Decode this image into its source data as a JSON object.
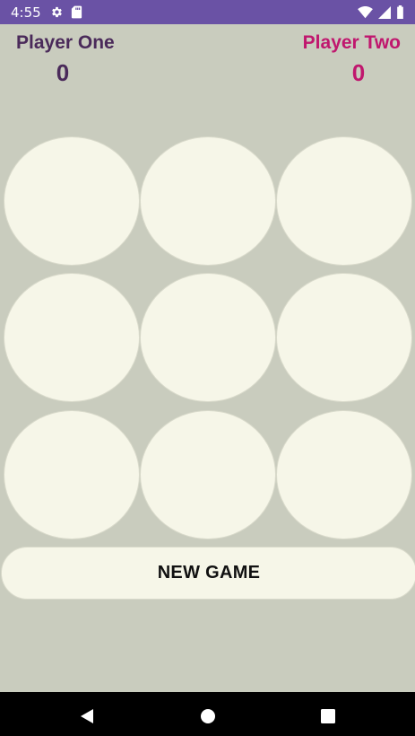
{
  "status_bar": {
    "time": "4:55",
    "icons_left": [
      "gear-icon",
      "sd-card-icon"
    ],
    "icons_right": [
      "wifi-icon",
      "signal-icon",
      "battery-icon"
    ],
    "background": "#6a52a5"
  },
  "scoreboard": {
    "player_one": {
      "name": "Player One",
      "score": "0",
      "color": "#4a2a5a"
    },
    "player_two": {
      "name": "Player Two",
      "score": "0",
      "color": "#c0176e"
    }
  },
  "board": {
    "rows": 3,
    "cols": 3,
    "cells": [
      "",
      "",
      "",
      "",
      "",
      "",
      "",
      "",
      ""
    ],
    "cell_color": "#f6f6e8"
  },
  "new_game_button": {
    "label": "NEW GAME"
  },
  "navigation": {
    "buttons": [
      "back-icon",
      "home-icon",
      "recents-icon"
    ]
  },
  "colors": {
    "background": "#c9ccbe",
    "nav_bar": "#000000"
  }
}
